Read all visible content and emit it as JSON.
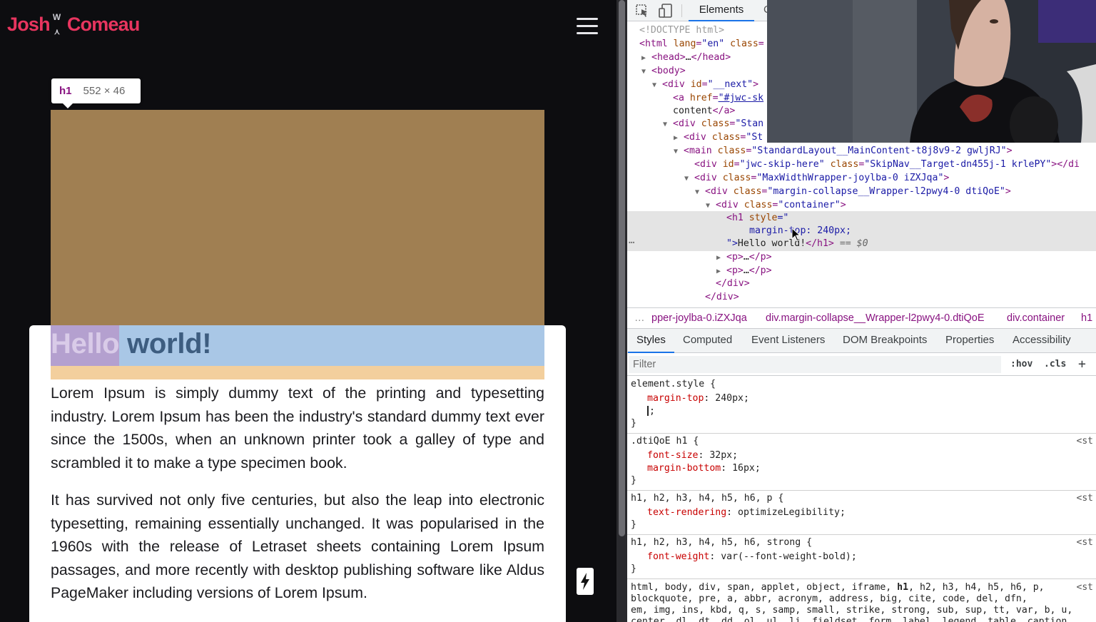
{
  "site": {
    "logo": {
      "first": "Josh",
      "last": "Comeau",
      "mark": "W"
    },
    "hover_badge": {
      "tag": "h1",
      "size": "552 × 46"
    },
    "heading": {
      "hello": "Hello",
      "rest": " world!"
    },
    "paragraphs": [
      "Lorem Ipsum is simply dummy text of the printing and typesetting industry. Lorem Ipsum has been the industry's standard dummy text ever since the 1500s, when an unknown printer took a galley of type and scrambled it to make a type specimen book.",
      "It has survived not only five centuries, but also the leap into electronic typesetting, remaining essentially unchanged. It was popularised in the 1960s with the release of Letraset sheets containing Lorem Ipsum passages, and more recently with desktop publishing software like Aldus PageMaker including versions of Lorem Ipsum."
    ],
    "colors": {
      "brand": "#e8355f",
      "margin_overlay": "#a07f52",
      "content_overlay": "#a9c7e6",
      "margin_bottom_overlay": "#f3cf9d"
    }
  },
  "devtools": {
    "top_tabs": {
      "elements": "Elements",
      "cut": "C"
    },
    "dom": {
      "doctype": "<!DOCTYPE html>",
      "html_open": {
        "tag": "<html",
        "attr1": "lang",
        "val1": "\"en\"",
        "attr2": "class"
      },
      "head": {
        "open": "<head>",
        "ellipsis": "…",
        "close": "</head>"
      },
      "body": "<body>",
      "next_div": {
        "open": "<div",
        "attr": "id",
        "val": "\"__next\"",
        "close": ">"
      },
      "skip_link": {
        "open": "<a",
        "attr": "href",
        "val": "\"#jwc-sk"
      },
      "content_line": {
        "text": "content",
        "close": "</a>"
      },
      "stan_div": {
        "open": "<div",
        "attr": "class",
        "val": "\"Stan"
      },
      "st_div": {
        "open": "<div",
        "attr": "class",
        "val": "\"St"
      },
      "main": {
        "open": "<main",
        "attr": "class",
        "val": "\"StandardLayout__MainContent-t8j8v9-2 gwljRJ\"",
        "close": ">"
      },
      "skip_target": {
        "open": "<div",
        "attr1": "id",
        "val1": "\"jwc-skip-here\"",
        "attr2": "class",
        "val2": "\"SkipNav__Target-dn455j-1 krlePY\"",
        "close": "></di"
      },
      "max_width": {
        "open": "<div",
        "attr": "class",
        "val": "\"MaxWidthWrapper-joylba-0 iZXJqa\"",
        "close": ">"
      },
      "margin_collapse": {
        "open": "<div",
        "attr": "class",
        "val": "\"margin-collapse__Wrapper-l2pwy4-0 dtiQoE\"",
        "close": ">"
      },
      "container": {
        "open": "<div",
        "attr": "class",
        "val": "\"container\"",
        "close": ">"
      },
      "h1_open": {
        "open": "<h1",
        "attr": "style",
        "val": "=\""
      },
      "h1_style": "margin-top: 240px;",
      "h1_close": {
        "quote": "\">",
        "text": "Hello world!",
        "close": "</h1>",
        "eq": "== $0"
      },
      "p1": {
        "open": "<p>",
        "ellipsis": "…",
        "close": "</p>"
      },
      "p2": {
        "open": "<p>",
        "ellipsis": "…",
        "close": "</p>"
      },
      "div_close1": "</div>",
      "div_close2": "</div>",
      "dots": "…"
    },
    "breadcrumbs": {
      "dots": "…",
      "items": [
        "pper-joylba-0.iZXJqa",
        "div.margin-collapse__Wrapper-l2pwy4-0.dtiQoE",
        "div.container",
        "h1"
      ]
    },
    "panel_tabs": [
      "Styles",
      "Computed",
      "Event Listeners",
      "DOM Breakpoints",
      "Properties",
      "Accessibility"
    ],
    "filter": {
      "placeholder": "Filter",
      "hov": ":hov",
      "cls": ".cls",
      "plus": "+"
    },
    "rules": {
      "element_style": {
        "selector": "element.style {",
        "prop": "margin-top",
        "value": "240px;",
        "empty_prop": ";",
        "close": "}"
      },
      "dtiqoe": {
        "selector": ".dtiQoE h1 {",
        "p1": "font-size",
        "v1": "32px;",
        "p2": "margin-bottom",
        "v2": "16px;",
        "close": "}",
        "source": "<st"
      },
      "legibility": {
        "selector": "h1, h2, h3, h4, h5, h6, p {",
        "prop": "text-rendering",
        "value": "optimizeLegibility;",
        "close": "}",
        "source": "<st"
      },
      "bold": {
        "selector": "h1, h2, h3, h4, h5, h6, strong {",
        "prop": "font-weight",
        "value": "var(--font-weight-bold);",
        "close": "}",
        "source": "<st"
      },
      "reset": {
        "line1_a": "html, body, div, span, applet, object, iframe, ",
        "line1_b": "h1",
        "line1_c": ", h2, h3, h4, h5, h6, p,",
        "line2": "blockquote, pre, a, abbr, acronym, address, big, cite, code, del, dfn,",
        "line3": "em, img, ins, kbd, q, s, samp, small, strike, strong, sub, sup, tt, var, b, u,",
        "line4": "center, dl, dt, dd, ol, ul, li, fieldset, form, label, legend, table, caption,",
        "source": "<st"
      }
    }
  }
}
